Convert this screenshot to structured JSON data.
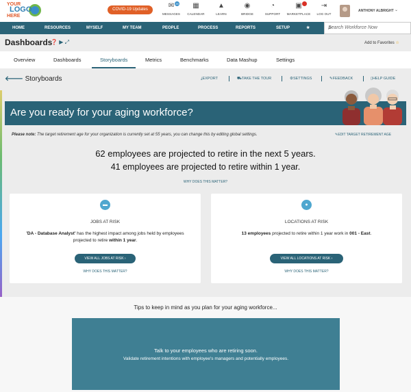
{
  "logo": {
    "line1": "YOUR",
    "line2": "LOGO",
    "line3": "HERE"
  },
  "header": {
    "covid_label": "COVID-19 Updates",
    "nav": [
      {
        "label": "MESSAGES",
        "icon": "messages-icon",
        "glyph": "✉"
      },
      {
        "label": "CALENDAR",
        "icon": "calendar-icon",
        "glyph": "▦"
      },
      {
        "label": "LEARN",
        "icon": "learn-icon",
        "glyph": "🎓"
      },
      {
        "label": "BRIDGE",
        "icon": "bridge-icon",
        "glyph": "◉"
      },
      {
        "label": "SUPPORT",
        "icon": "support-icon",
        "glyph": "💬"
      },
      {
        "label": "MARKETPLACE",
        "icon": "marketplace-icon",
        "glyph": "🏬"
      },
      {
        "label": "LOG OUT",
        "icon": "logout-icon",
        "glyph": "⇥"
      }
    ],
    "user_name": "ANTHONY ALBRIGHT",
    "messages_badge": "25"
  },
  "mainnav": {
    "items": [
      "HOME",
      "RESOURCES",
      "MYSELF",
      "MY TEAM",
      "PEOPLE",
      "PROCESS",
      "REPORTS",
      "SETUP"
    ],
    "star": "★",
    "search_placeholder": "Search Workforce Now"
  },
  "page": {
    "title": "Dashboards",
    "add_favorites": "Add to Favorites"
  },
  "tabs": [
    "Overview",
    "Dashboards",
    "Storyboards",
    "Metrics",
    "Benchmarks",
    "Data Mashup",
    "Settings"
  ],
  "active_tab": "Storyboards",
  "storyboard": {
    "title": "Storyboards",
    "actions": [
      "EXPORT",
      "TAKE THE TOUR",
      "SETTINGS",
      "FEEDBACK",
      "HELP GUIDE"
    ]
  },
  "banner": {
    "title": "Are you ready for your aging workforce?"
  },
  "note": {
    "label": "Please note:",
    "text": " The target retirement age for your organization is currently set at 55 years, you can change this by editing global settings.",
    "edit_link": "EDIT TARGET RETIREMENT AGE"
  },
  "summary": {
    "line1": "62 employees are projected to retire in the next 5 years.",
    "line2": "41 employees are projected to retire within 1 year.",
    "why": "WHY DOES THIS MATTER?"
  },
  "cards": [
    {
      "title": "JOBS AT RISK",
      "body_bold1": "'DA - Database Analyst'",
      "body_text": " has the highest impact among jobs held by employees projected to retire ",
      "body_bold2": "within 1 year",
      "body_end": ".",
      "button": "VIEW ALL JOBS AT RISK ›",
      "why": "WHY DOES THIS MATTER?"
    },
    {
      "title": "LOCATIONS AT RISK",
      "body_bold1": "13 employees",
      "body_text": " projected to retire within 1 year work in ",
      "body_bold2": "001 - East",
      "body_end": ".",
      "button": "VIEW ALL LOCATIONS AT RISK ›",
      "why": "WHY DOES THIS MATTER?"
    }
  ],
  "tips": {
    "heading": "Tips to keep in mind as you plan for your aging workforce...",
    "tip_title": "Talk to your employees who are retiring soon.",
    "tip_text": "Validate retirement intentions with employee's managers and potentially employees."
  }
}
